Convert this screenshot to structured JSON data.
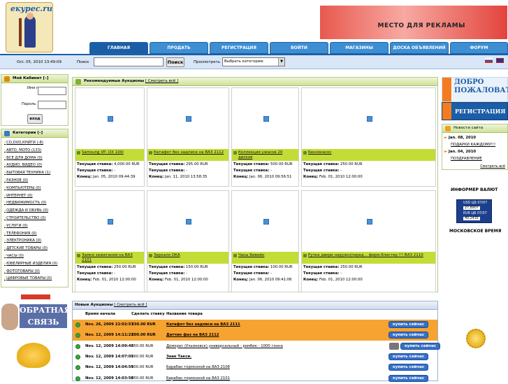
{
  "site": {
    "logo_text": "екурес.ru",
    "ad_text": "МЕСТО ДЛЯ РЕКЛАМЫ",
    "datetime": "Oct. 05, 2010 13:49:09"
  },
  "nav": [
    "ГЛАВНАЯ",
    "ПРОДАТЬ",
    "РЕГИСТРАЦИЯ",
    "ВОЙТИ",
    "МАГАЗИНЫ",
    "ДОСКА ОБЪЯВЛЕНИЙ",
    "ФОРУМ"
  ],
  "search": {
    "label": "Поиск",
    "value": "",
    "button": "Поиск",
    "browse_label": "Просмотреть",
    "category": "Выбрать категорию"
  },
  "cabinet": {
    "title": "Мой Кабинет [–]",
    "user_label": "Имя пользователя",
    "pass_label": "Пароль",
    "login_button": "вход"
  },
  "categories": {
    "title": "Категории [–]",
    "items": [
      "CD,DVD,КНИГИ (-8)",
      "АВТО, МОТО (133)",
      "ВСЕ ДЛЯ ДОМА (0)",
      "АУДИО, ВИДЕО (0)",
      "БЫТОВАЯ ТЕХНИКА (1)",
      "РАЗНОЕ (0)",
      "КОМПЬЮТЕРЫ (0)",
      "ИНТЕРНЕТ (0)",
      "НЕДВИЖИМОСТЬ (0)",
      "ОДЕЖДА И ОБУВЬ (0)",
      "СТРОИТЕЛЬСТВО (0)",
      "УСЛУГИ (0)",
      "ТЕЛЕФОНИЯ (0)",
      "ЭЛЕКТРОНИКА (0)",
      "ДЕТСКИЕ ТОВАРЫ (0)",
      "ЧАСЫ (0)",
      "ЮВЕЛИРНЫЕ ИЗДЕЛИЯ (0)",
      "ФОТОТОВАРЫ (0)",
      "ЦИФРОВЫЕ ТОВАРЫ (0)"
    ]
  },
  "feedback": "ОБРАТНАЯ СВЯЗЬ",
  "recommended": {
    "title": "Рекомендуемые Аукционы",
    "view_all": "[ Смотреть всё ]",
    "bid_label": "Текущая ставка:",
    "end_label": "Конец:",
    "cur_label": "Текущая ставка:",
    "cards": [
      {
        "title": "Samsung VP- DX 100i",
        "bid": "4,000.00 RUR",
        "cur": "-",
        "end": "Jan. 05, 2010 09:44:39"
      },
      {
        "title": "Катафот без надписи на ВАЗ 2112",
        "bid": "295.00 RUR",
        "cur": "-",
        "end": "Jan. 11, 2010 13:58:35"
      },
      {
        "title": "Коллекция ужасов 20 дисков",
        "bid": "500.00 RUR",
        "cur": "-",
        "end": "Jan. 06, 2010 09:56:51"
      },
      {
        "title": "Бензонасос",
        "bid": "250.00 RUR",
        "cur": "-",
        "end": "Feb. 01, 2010 12:00:00"
      },
      {
        "title": "Замки зажигания на ВАЗ 2101",
        "bid": "250.00 RUR",
        "cur": "-",
        "end": "Feb. 01, 2010 12:00:00"
      },
      {
        "title": "Зеркало ОКА",
        "bid": "150.00 RUR",
        "cur": "-",
        "end": "Feb. 01, 2010 12:00:00"
      },
      {
        "title": "Часы Бивейн",
        "bid": "100.00 RUR",
        "cur": "-",
        "end": "Jan. 06, 2010 09:41:06"
      },
      {
        "title": "Ручка двери наружн(перед... фирм.блистер !!! ВАЗ 2110",
        "bid": "250.00 RUR",
        "cur": "-",
        "end": "Feb. 01, 2010 12:00:00"
      }
    ]
  },
  "newauctions": {
    "title": "Новые Аукционы",
    "view_all": "[ Смотреть всё ]",
    "cols": [
      "Время начала",
      "Сделать ставку",
      "Название товара"
    ],
    "buy": "купить сейчас",
    "rows": [
      {
        "time": "Nov. 26, 2009 22:02:57",
        "price": "330.00 RUR",
        "name": "Катафот без надписи на ВАЗ 2111",
        "hl": true
      },
      {
        "time": "Nov. 12, 2009 14:11:23",
        "price": "200.00 RUR",
        "name": "Датчик фаз на ВАЗ 2112",
        "hl": true
      },
      {
        "time": "Nov. 12, 2009 14:09:40",
        "price": "350.00 RUR",
        "name": "Домкрат (Ульяновск) универсальный - ромбик - 1000 тонна",
        "hl": false
      },
      {
        "time": "Nov. 12, 2009 14:07:05",
        "price": "260.00 RUR",
        "name": "Знак Такси.",
        "hl": false
      },
      {
        "time": "Nov. 12, 2009 14:04:59",
        "price": "500.00 RUR",
        "name": "Барабан тормозной на ВАЗ 2108",
        "hl": false
      },
      {
        "time": "Nov. 12, 2009 14:03:50",
        "price": "650.00 RUR",
        "name": "Барабан тормозной на ВАЗ 2101",
        "hl": false
      }
    ]
  },
  "welcome": {
    "line1": "ДОБРО",
    "line2": "ПОЖАЛОВАТЬ!!!",
    "reg": "РЕГИСТРАЦИЯ"
  },
  "news": {
    "title": "Новости сайта",
    "items": [
      {
        "date": "Jan. 08, 2010",
        "text": "ПОДАРКИ КАЖДОМУ!!!"
      },
      {
        "date": "Jan. 04, 2010",
        "text": "ПОЗДРАВЛЕНИЕ"
      }
    ],
    "view_all": "Смотреть всё"
  },
  "informer": {
    "title": "ИНФОРМЕР ВАЛЮТ",
    "usd_label": "USD ЦБ",
    "usd_date": "07/07",
    "usd_val": "27,8907",
    "eur_label": "EUR ЦБ",
    "eur_date": "07/07",
    "eur_val": "40,2435",
    "msk": "МОСКОВСКОЕ ВРЕМЯ"
  }
}
